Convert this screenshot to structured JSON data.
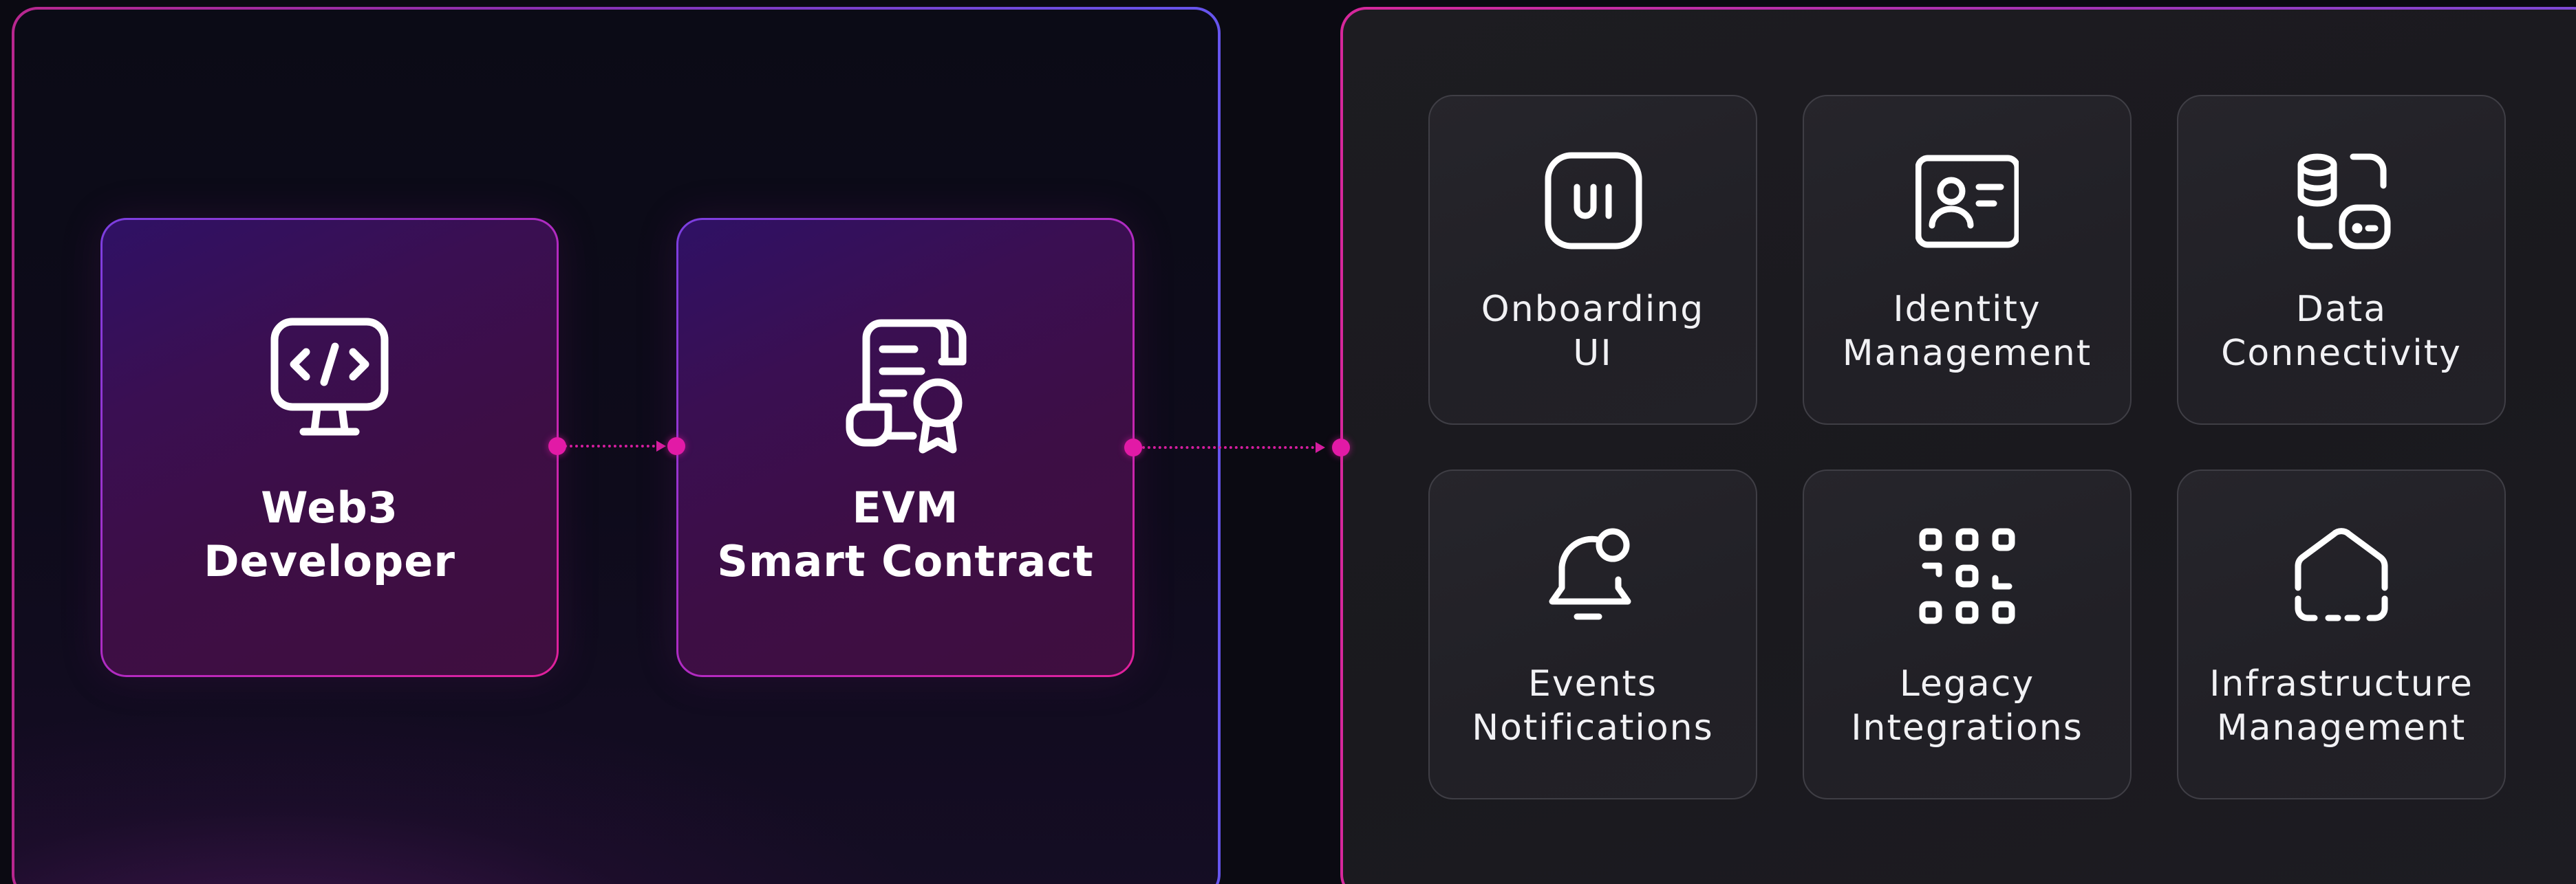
{
  "developer_node": {
    "line1": "Web3",
    "line2": "Developer",
    "icon": "code-monitor-icon"
  },
  "contract_node": {
    "line1": "EVM",
    "line2": "Smart Contract",
    "icon": "certificate-scroll-icon"
  },
  "services": [
    {
      "line1": "Onboarding",
      "line2": "UI",
      "icon": "ui-badge-icon"
    },
    {
      "line1": "Identity",
      "line2": "Management",
      "icon": "id-card-icon"
    },
    {
      "line1": "Data",
      "line2": "Connectivity",
      "icon": "database-drive-icon"
    },
    {
      "line1": "Events",
      "line2": "Notifications",
      "icon": "bell-notification-icon"
    },
    {
      "line1": "Legacy",
      "line2": "Integrations",
      "icon": "grid-integration-icon"
    },
    {
      "line1": "Infrastructure",
      "line2": "Management",
      "icon": "house-outline-icon"
    }
  ],
  "colors": {
    "connector": "#d41d9e",
    "node_fill": "#3d0e45",
    "tile_fill": "#232228",
    "text": "#ffffff"
  }
}
